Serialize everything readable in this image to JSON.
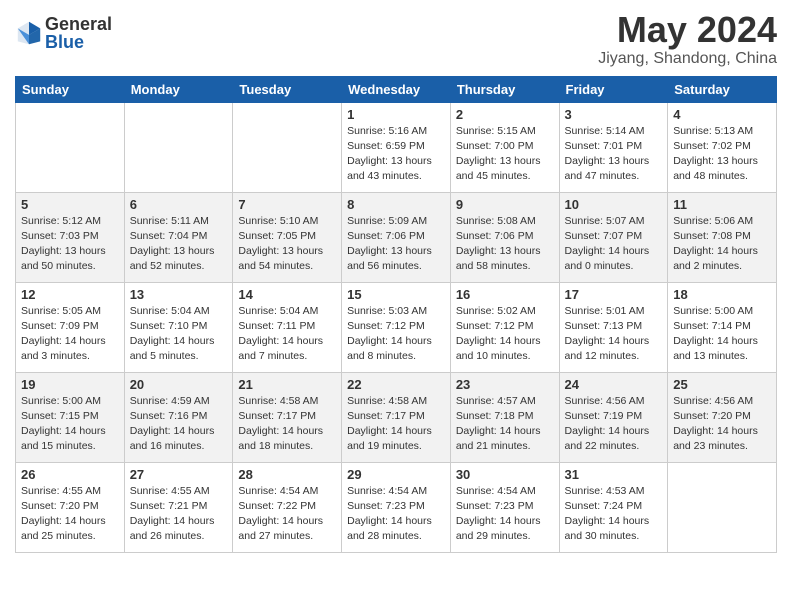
{
  "header": {
    "logo_general": "General",
    "logo_blue": "Blue",
    "title": "May 2024",
    "location": "Jiyang, Shandong, China"
  },
  "weekdays": [
    "Sunday",
    "Monday",
    "Tuesday",
    "Wednesday",
    "Thursday",
    "Friday",
    "Saturday"
  ],
  "weeks": [
    [
      {
        "day": "",
        "info": ""
      },
      {
        "day": "",
        "info": ""
      },
      {
        "day": "",
        "info": ""
      },
      {
        "day": "1",
        "info": "Sunrise: 5:16 AM\nSunset: 6:59 PM\nDaylight: 13 hours\nand 43 minutes."
      },
      {
        "day": "2",
        "info": "Sunrise: 5:15 AM\nSunset: 7:00 PM\nDaylight: 13 hours\nand 45 minutes."
      },
      {
        "day": "3",
        "info": "Sunrise: 5:14 AM\nSunset: 7:01 PM\nDaylight: 13 hours\nand 47 minutes."
      },
      {
        "day": "4",
        "info": "Sunrise: 5:13 AM\nSunset: 7:02 PM\nDaylight: 13 hours\nand 48 minutes."
      }
    ],
    [
      {
        "day": "5",
        "info": "Sunrise: 5:12 AM\nSunset: 7:03 PM\nDaylight: 13 hours\nand 50 minutes."
      },
      {
        "day": "6",
        "info": "Sunrise: 5:11 AM\nSunset: 7:04 PM\nDaylight: 13 hours\nand 52 minutes."
      },
      {
        "day": "7",
        "info": "Sunrise: 5:10 AM\nSunset: 7:05 PM\nDaylight: 13 hours\nand 54 minutes."
      },
      {
        "day": "8",
        "info": "Sunrise: 5:09 AM\nSunset: 7:06 PM\nDaylight: 13 hours\nand 56 minutes."
      },
      {
        "day": "9",
        "info": "Sunrise: 5:08 AM\nSunset: 7:06 PM\nDaylight: 13 hours\nand 58 minutes."
      },
      {
        "day": "10",
        "info": "Sunrise: 5:07 AM\nSunset: 7:07 PM\nDaylight: 14 hours\nand 0 minutes."
      },
      {
        "day": "11",
        "info": "Sunrise: 5:06 AM\nSunset: 7:08 PM\nDaylight: 14 hours\nand 2 minutes."
      }
    ],
    [
      {
        "day": "12",
        "info": "Sunrise: 5:05 AM\nSunset: 7:09 PM\nDaylight: 14 hours\nand 3 minutes."
      },
      {
        "day": "13",
        "info": "Sunrise: 5:04 AM\nSunset: 7:10 PM\nDaylight: 14 hours\nand 5 minutes."
      },
      {
        "day": "14",
        "info": "Sunrise: 5:04 AM\nSunset: 7:11 PM\nDaylight: 14 hours\nand 7 minutes."
      },
      {
        "day": "15",
        "info": "Sunrise: 5:03 AM\nSunset: 7:12 PM\nDaylight: 14 hours\nand 8 minutes."
      },
      {
        "day": "16",
        "info": "Sunrise: 5:02 AM\nSunset: 7:12 PM\nDaylight: 14 hours\nand 10 minutes."
      },
      {
        "day": "17",
        "info": "Sunrise: 5:01 AM\nSunset: 7:13 PM\nDaylight: 14 hours\nand 12 minutes."
      },
      {
        "day": "18",
        "info": "Sunrise: 5:00 AM\nSunset: 7:14 PM\nDaylight: 14 hours\nand 13 minutes."
      }
    ],
    [
      {
        "day": "19",
        "info": "Sunrise: 5:00 AM\nSunset: 7:15 PM\nDaylight: 14 hours\nand 15 minutes."
      },
      {
        "day": "20",
        "info": "Sunrise: 4:59 AM\nSunset: 7:16 PM\nDaylight: 14 hours\nand 16 minutes."
      },
      {
        "day": "21",
        "info": "Sunrise: 4:58 AM\nSunset: 7:17 PM\nDaylight: 14 hours\nand 18 minutes."
      },
      {
        "day": "22",
        "info": "Sunrise: 4:58 AM\nSunset: 7:17 PM\nDaylight: 14 hours\nand 19 minutes."
      },
      {
        "day": "23",
        "info": "Sunrise: 4:57 AM\nSunset: 7:18 PM\nDaylight: 14 hours\nand 21 minutes."
      },
      {
        "day": "24",
        "info": "Sunrise: 4:56 AM\nSunset: 7:19 PM\nDaylight: 14 hours\nand 22 minutes."
      },
      {
        "day": "25",
        "info": "Sunrise: 4:56 AM\nSunset: 7:20 PM\nDaylight: 14 hours\nand 23 minutes."
      }
    ],
    [
      {
        "day": "26",
        "info": "Sunrise: 4:55 AM\nSunset: 7:20 PM\nDaylight: 14 hours\nand 25 minutes."
      },
      {
        "day": "27",
        "info": "Sunrise: 4:55 AM\nSunset: 7:21 PM\nDaylight: 14 hours\nand 26 minutes."
      },
      {
        "day": "28",
        "info": "Sunrise: 4:54 AM\nSunset: 7:22 PM\nDaylight: 14 hours\nand 27 minutes."
      },
      {
        "day": "29",
        "info": "Sunrise: 4:54 AM\nSunset: 7:23 PM\nDaylight: 14 hours\nand 28 minutes."
      },
      {
        "day": "30",
        "info": "Sunrise: 4:54 AM\nSunset: 7:23 PM\nDaylight: 14 hours\nand 29 minutes."
      },
      {
        "day": "31",
        "info": "Sunrise: 4:53 AM\nSunset: 7:24 PM\nDaylight: 14 hours\nand 30 minutes."
      },
      {
        "day": "",
        "info": ""
      }
    ]
  ]
}
